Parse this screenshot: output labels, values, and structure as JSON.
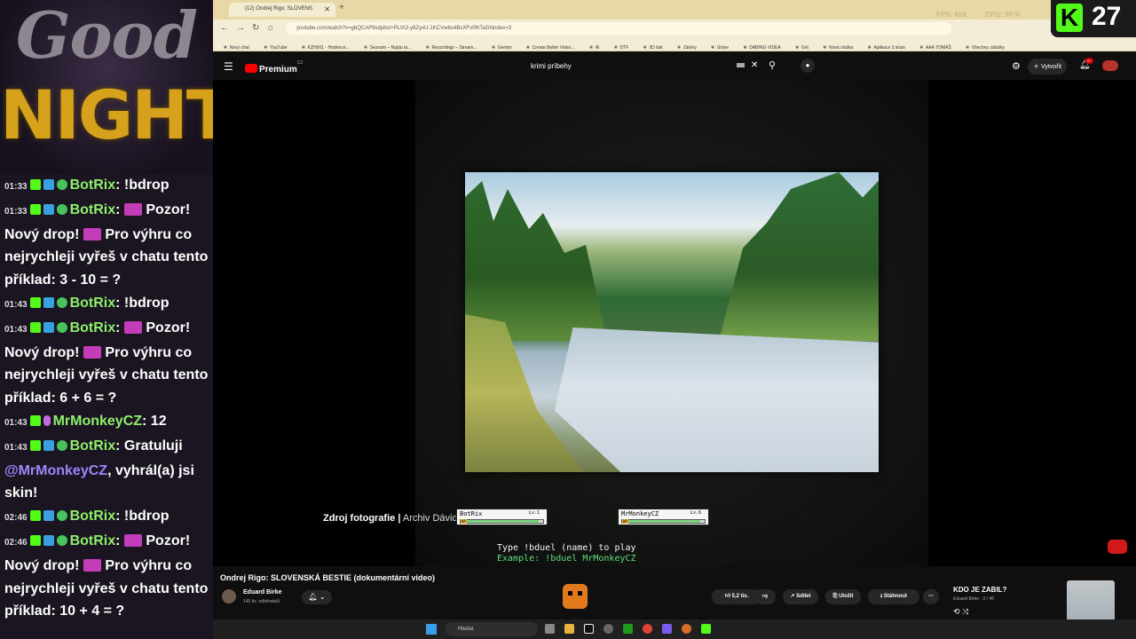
{
  "overlay": {
    "good": "Good",
    "night": "NIGHT"
  },
  "chat": [
    {
      "time": "01:33",
      "user": "BotRix",
      "text": ": !bdrop"
    },
    {
      "time": "01:33",
      "user": "BotRix",
      "text": ": ",
      "emote": true,
      "tail": "Pozor! Nový drop! ",
      "emote2": true,
      "tail2": "Pro výhru co nejrychleji vyřeš v chatu tento příklad: 3 - 10 = ?"
    },
    {
      "time": "01:43",
      "user": "BotRix",
      "text": ": !bdrop"
    },
    {
      "time": "01:43",
      "user": "BotRix",
      "text": ": ",
      "emote": true,
      "tail": "Pozor! Nový drop! ",
      "emote2": true,
      "tail2": "Pro výhru co nejrychleji vyřeš v chatu tento příklad: 6 + 6 = ?"
    },
    {
      "time": "01:43",
      "user": "MrMonkeyCZ",
      "text": ": 12"
    },
    {
      "time": "01:43",
      "user": "BotRix",
      "text": ": Gratuluji",
      "mention": "@MrMonkeyCZ",
      "tail": ", vyhrál(a) jsi skin!"
    },
    {
      "time": "02:46",
      "user": "BotRix",
      "text": ": !bdrop"
    },
    {
      "time": "02:46",
      "user": "BotRix",
      "text": ": ",
      "emote": true,
      "tail": "Pozor! Nový drop! ",
      "emote2": true,
      "tail2": "Pro výhru co nejrychleji vyřeš v chatu tento příklad: 10 + 4 = ?"
    }
  ],
  "browser": {
    "tab_title": "(12) Ondrej Rigo: SLOVENS",
    "url": "youtube.com/watch?v=gbQCAP9sdpbst+PLfA3-y8ZyxU-1KCVw8u4BsXFv0fhTaGhindex=3",
    "bookmarks": [
      "Nový chat",
      "YouTube",
      "KZH001 - Hodnoce...",
      "Seznam – Najdu ta...",
      "Recordings – Stream...",
      "Gemini",
      "Create Better Video...",
      "AI",
      "DTF",
      "3D tisk",
      "Zálohy",
      "Úrbev",
      "DABING VIDEA",
      "Grit",
      "Nová složka",
      "Aplikace 3 stran",
      "AAA TOMÁŠ",
      "Všechny záložky"
    ]
  },
  "youtube": {
    "logo": "Premium",
    "logo_sup": "CZ",
    "search_value": "krimi príbehy",
    "create_label": "Vytvořit",
    "notif_count": "9+"
  },
  "video": {
    "photo_credit_bold": "Zdroj fotografie |",
    "photo_credit_rest": " Archiv Dávid",
    "duel": [
      {
        "name": "BotRix",
        "level": "Lv.1",
        "hp": 0.95
      },
      {
        "name": "MrMonkeyCZ",
        "level": "Lv.6",
        "hp": 0.95
      }
    ],
    "hp_tag": "HP",
    "play_line1": "Type !bduel (name) to play",
    "play_line2": "Example: !bduel MrMonkeyCZ"
  },
  "below": {
    "title": "Ondrej Rigo: SLOVENSKÁ BESTIE (dokumentární video)",
    "channel": "Eduard Birke",
    "subs": "145 tis. odběratelů",
    "likes": "5,2 tis.",
    "share": "Sdílet",
    "save": "Uložit",
    "download": "Stáhnout",
    "next_title": "KDO JE ZABIL?",
    "next_sub": "Eduard Birke - 3 / 48"
  },
  "taskbar": {
    "search": "Hledat"
  },
  "stats": {
    "fps": "FPS: N/A",
    "cpu": "CPU: 30 %"
  },
  "kick": {
    "letter": "K",
    "viewers": "27"
  },
  "colors": {
    "kick_green": "#53fc18",
    "yt_red": "#ff0000",
    "night_gold": "#d7a21b"
  }
}
